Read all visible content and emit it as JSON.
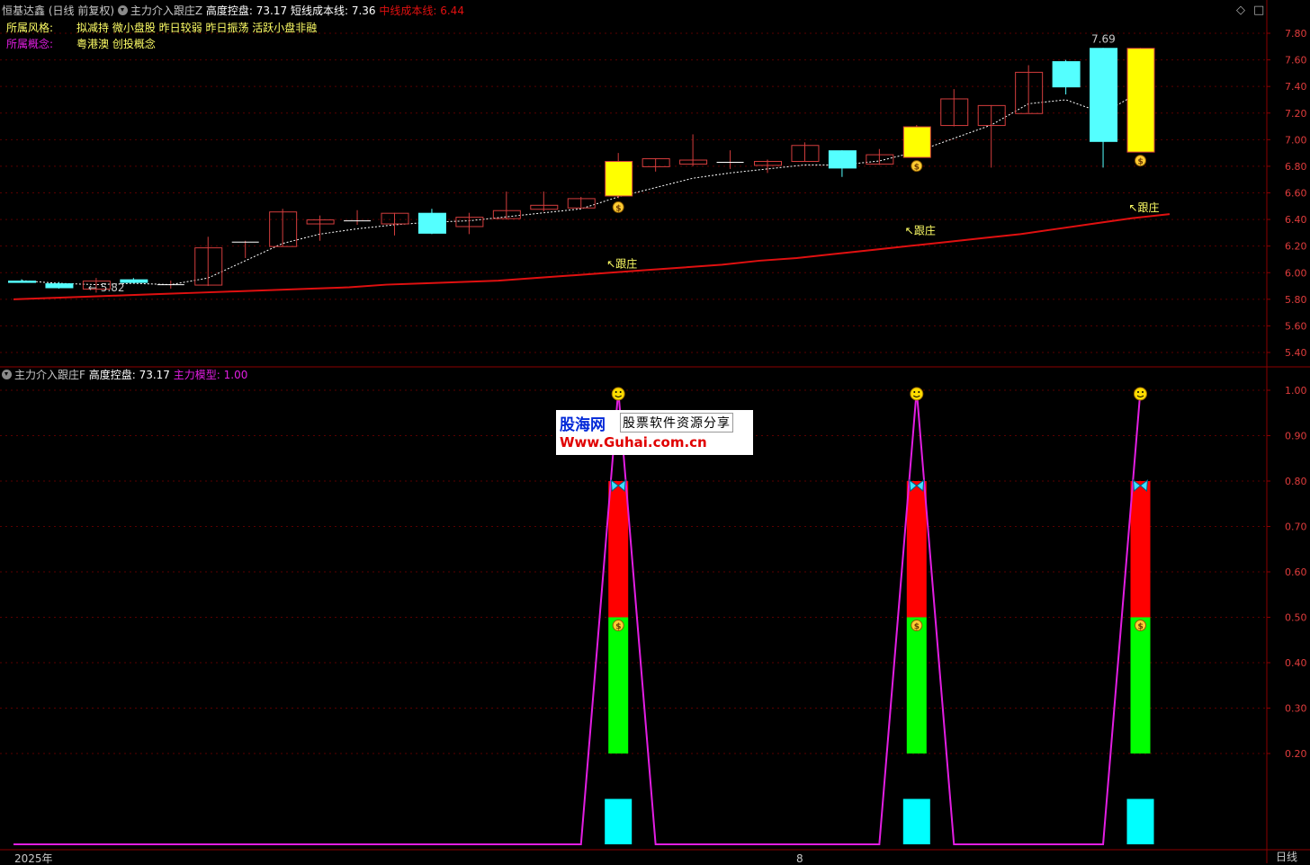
{
  "header": {
    "stock_name": "恒基达鑫",
    "period_mode": "(日线 前复权)",
    "indicator1_name": "主力介入跟庄Z",
    "indicator1_field1": "高度控盘: 73.17",
    "indicator1_field2": "短线成本线: 7.36",
    "indicator1_field3": "中线成本线: 6.44",
    "style_label": "所属风格:",
    "style_value": "拟减持 微小盘股 昨日较弱 昨日振荡 活跃小盘非融",
    "concept_label": "所属概念:",
    "concept_value": "粤港澳 创投概念",
    "indicator2_name": "主力介入跟庄F",
    "indicator2_field1": "高度控盘: 73.17",
    "indicator2_field2": "主力模型: 1.00"
  },
  "window_controls": {
    "restore_glyph": "◇",
    "maximize_glyph": "□"
  },
  "footer": {
    "year_label": "2025年",
    "month_label": "8",
    "period_label": "日线"
  },
  "watermark": {
    "brand": "股海网",
    "slogan": "股票软件资源分享",
    "url": "Www.Guhai.com.cn"
  },
  "colors": {
    "bg": "#000000",
    "grid": "#5a0000",
    "axis": "#8b0000",
    "up": "#d33d3d",
    "down": "#54ffff",
    "signal": "#ffff00",
    "short_cost": "#ffffff",
    "mid_cost": "#e01010",
    "model": "#e21ee2",
    "red_bar": "#ff0000",
    "green_bar": "#00ff00",
    "cyan_bar": "#00ffff"
  },
  "chart_data": [
    {
      "type": "candlestick",
      "title": "主力介入跟庄Z",
      "ylim": [
        5.32,
        7.88
      ],
      "yticks": [
        5.4,
        5.6,
        5.8,
        6.0,
        6.2,
        6.4,
        6.6,
        6.8,
        7.0,
        7.2,
        7.4,
        7.6,
        7.8
      ],
      "grid": true,
      "candles": [
        {
          "o": 5.94,
          "h": 5.95,
          "l": 5.93,
          "c": 5.93
        },
        {
          "o": 5.92,
          "h": 5.93,
          "l": 5.88,
          "c": 5.89
        },
        {
          "o": 5.88,
          "h": 5.96,
          "l": 5.85,
          "c": 5.94
        },
        {
          "o": 5.95,
          "h": 5.96,
          "l": 5.92,
          "c": 5.93
        },
        {
          "o": 5.91,
          "h": 5.94,
          "l": 5.88,
          "c": 5.91
        },
        {
          "o": 5.91,
          "h": 6.27,
          "l": 5.9,
          "c": 6.19
        },
        {
          "o": 6.23,
          "h": 6.24,
          "l": 6.11,
          "c": 6.23
        },
        {
          "o": 6.2,
          "h": 6.48,
          "l": 6.2,
          "c": 6.46
        },
        {
          "o": 6.37,
          "h": 6.43,
          "l": 6.24,
          "c": 6.4
        },
        {
          "o": 6.39,
          "h": 6.47,
          "l": 6.36,
          "c": 6.39
        },
        {
          "o": 6.37,
          "h": 6.45,
          "l": 6.28,
          "c": 6.45
        },
        {
          "o": 6.45,
          "h": 6.48,
          "l": 6.29,
          "c": 6.3
        },
        {
          "o": 6.35,
          "h": 6.45,
          "l": 6.29,
          "c": 6.42
        },
        {
          "o": 6.41,
          "h": 6.61,
          "l": 6.4,
          "c": 6.47
        },
        {
          "o": 6.48,
          "h": 6.61,
          "l": 6.46,
          "c": 6.51
        },
        {
          "o": 6.49,
          "h": 6.57,
          "l": 6.49,
          "c": 6.56
        },
        {
          "o": 6.58,
          "h": 6.9,
          "l": 6.56,
          "c": 6.84
        },
        {
          "o": 6.8,
          "h": 6.86,
          "l": 6.76,
          "c": 6.86
        },
        {
          "o": 6.82,
          "h": 7.04,
          "l": 6.8,
          "c": 6.85
        },
        {
          "o": 6.83,
          "h": 6.92,
          "l": 6.78,
          "c": 6.83
        },
        {
          "o": 6.81,
          "h": 6.85,
          "l": 6.75,
          "c": 6.84
        },
        {
          "o": 6.84,
          "h": 6.98,
          "l": 6.84,
          "c": 6.96
        },
        {
          "o": 6.92,
          "h": 6.92,
          "l": 6.72,
          "c": 6.79
        },
        {
          "o": 6.82,
          "h": 6.93,
          "l": 6.81,
          "c": 6.89
        },
        {
          "o": 6.87,
          "h": 7.11,
          "l": 6.87,
          "c": 7.1
        },
        {
          "o": 7.11,
          "h": 7.38,
          "l": 7.1,
          "c": 7.31
        },
        {
          "o": 7.11,
          "h": 7.26,
          "l": 6.79,
          "c": 7.26
        },
        {
          "o": 7.2,
          "h": 7.56,
          "l": 7.2,
          "c": 7.51
        },
        {
          "o": 7.59,
          "h": 7.6,
          "l": 7.34,
          "c": 7.4
        },
        {
          "o": 7.69,
          "h": 7.69,
          "l": 6.79,
          "c": 6.99
        },
        {
          "o": 6.91,
          "h": 7.69,
          "l": 6.91,
          "c": 7.69
        }
      ],
      "signal_candles": [
        16,
        24,
        30
      ],
      "short_cost_line": [
        5.94,
        5.92,
        5.91,
        5.92,
        5.91,
        5.96,
        6.09,
        6.22,
        6.29,
        6.33,
        6.36,
        6.38,
        6.39,
        6.42,
        6.45,
        6.48,
        6.57,
        6.64,
        6.71,
        6.75,
        6.78,
        6.81,
        6.81,
        6.84,
        6.91,
        7.01,
        7.11,
        7.27,
        7.3,
        7.2,
        7.36
      ],
      "mid_cost_line": [
        5.8,
        5.81,
        5.82,
        5.83,
        5.84,
        5.85,
        5.86,
        5.87,
        5.88,
        5.89,
        5.91,
        5.92,
        5.93,
        5.94,
        5.96,
        5.98,
        6.0,
        6.02,
        6.04,
        6.06,
        6.09,
        6.11,
        6.14,
        6.17,
        6.2,
        6.23,
        6.26,
        6.29,
        6.33,
        6.37,
        6.41,
        6.44
      ],
      "annotations": [
        {
          "text": "← 5.82",
          "index": 2,
          "value": 5.82
        },
        {
          "text": "↖跟庄",
          "index": 16,
          "value": 6.0
        },
        {
          "text": "↖跟庄",
          "index": 24,
          "value": 6.25
        },
        {
          "text": "↖跟庄",
          "index": 30,
          "value": 6.42
        },
        {
          "text": "7.69",
          "index": 29,
          "value": 7.69
        }
      ]
    },
    {
      "type": "bar",
      "title": "主力介入跟庄F",
      "ylim": [
        0.0,
        1.05
      ],
      "yticks": [
        0.2,
        0.3,
        0.4,
        0.5,
        0.6,
        0.7,
        0.8,
        0.9,
        1.0
      ],
      "grid": true,
      "stacked_bars": [
        {
          "index": 16,
          "cyan": [
            0.0,
            0.1
          ],
          "green": [
            0.1,
            0.5
          ],
          "red": [
            0.5,
            0.8
          ]
        },
        {
          "index": 24,
          "cyan": [
            0.0,
            0.1
          ],
          "green": [
            0.1,
            0.5
          ],
          "red": [
            0.5,
            0.8
          ]
        },
        {
          "index": 30,
          "cyan": [
            0.0,
            0.1
          ],
          "green": [
            0.1,
            0.5
          ],
          "red": [
            0.5,
            0.8
          ]
        }
      ],
      "model_line": {
        "name": "主力模型",
        "points": [
          [
            0,
            0
          ],
          [
            15,
            0
          ],
          [
            16,
            1
          ],
          [
            17,
            0
          ],
          [
            23,
            0
          ],
          [
            24,
            1
          ],
          [
            25,
            0
          ],
          [
            29,
            0
          ],
          [
            30,
            1
          ]
        ]
      },
      "markers": [
        {
          "icon": "smiley-icon",
          "index": 16,
          "value": 1.0
        },
        {
          "icon": "smiley-icon",
          "index": 24,
          "value": 1.0
        },
        {
          "icon": "smiley-icon",
          "index": 30,
          "value": 1.0
        },
        {
          "icon": "butterfly-icon",
          "index": 16,
          "value": 0.79
        },
        {
          "icon": "butterfly-icon",
          "index": 24,
          "value": 0.79
        },
        {
          "icon": "butterfly-icon",
          "index": 30,
          "value": 0.79
        },
        {
          "icon": "money-bag-icon",
          "index": 16,
          "value": 0.49
        },
        {
          "icon": "money-bag-icon",
          "index": 24,
          "value": 0.49
        },
        {
          "icon": "money-bag-icon",
          "index": 30,
          "value": 0.49
        }
      ]
    }
  ]
}
